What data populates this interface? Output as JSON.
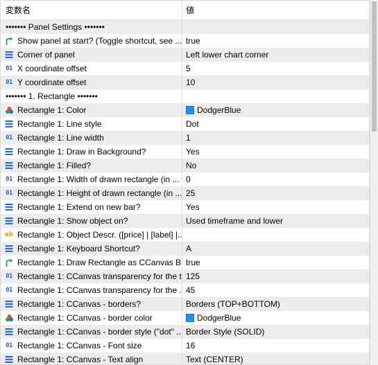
{
  "header": {
    "col_name": "変数名",
    "col_value": "値"
  },
  "rows": [
    {
      "type": "section",
      "name": "••••••• Panel Settings •••••••",
      "value": ""
    },
    {
      "icon": "arrow-green",
      "name": "Show panel at start? (Toggle shortcut, see ...",
      "value": "true"
    },
    {
      "icon": "enum",
      "name": "Corner of panel",
      "value": "Left lower chart corner"
    },
    {
      "icon": "int",
      "name": "X coordinate offset",
      "value": "5"
    },
    {
      "icon": "int",
      "name": "Y coordinate offset",
      "value": "10"
    },
    {
      "type": "section",
      "name": "••••••• 1. Rectangle •••••••",
      "value": ""
    },
    {
      "icon": "color",
      "name": "Rectangle 1: Color",
      "value": "DodgerBlue",
      "swatch": "#1e90ff"
    },
    {
      "icon": "enum",
      "name": "Rectangle 1: Line style",
      "value": "Dot"
    },
    {
      "icon": "int",
      "name": "Rectangle 1: Line width",
      "value": "1"
    },
    {
      "icon": "enum",
      "name": "Rectangle 1: Draw in Background?",
      "value": "Yes"
    },
    {
      "icon": "enum",
      "name": "Rectangle 1: Filled?",
      "value": "No"
    },
    {
      "icon": "int",
      "name": "Rectangle 1: Width of drawn rectangle (in ...",
      "value": "0"
    },
    {
      "icon": "int",
      "name": "Rectangle 1: Height of drawn rectangle (in ...",
      "value": "25"
    },
    {
      "icon": "enum",
      "name": "Rectangle 1: Extend on new bar?",
      "value": "Yes"
    },
    {
      "icon": "enum",
      "name": "Rectangle 1: Show object on?",
      "value": "Used timeframe and lower"
    },
    {
      "icon": "string",
      "name": "Rectangle 1: Object Descr. ([price] | [label] |...",
      "value": ""
    },
    {
      "icon": "enum",
      "name": "Rectangle 1: Keyboard Shortcut?",
      "value": "A"
    },
    {
      "icon": "arrow-green",
      "name": "Rectangle 1: Draw Rectangle as CCanvas Bit...",
      "value": "true"
    },
    {
      "icon": "int",
      "name": "Rectangle 1: CCanvas transparency for the t...",
      "value": "125"
    },
    {
      "icon": "int",
      "name": "Rectangle 1: CCanvas transparency for the ...",
      "value": "45"
    },
    {
      "icon": "enum",
      "name": "Rectangle 1: CCanvas - borders?",
      "value": "Borders (TOP+BOTTOM)"
    },
    {
      "icon": "color",
      "name": "Rectangle 1: CCanvas - border color",
      "value": "DodgerBlue",
      "swatch": "#1e90ff"
    },
    {
      "icon": "enum",
      "name": "Rectangle 1: CCanvas - border style (\"dot\" ...",
      "value": "Border Style (SOLID)"
    },
    {
      "icon": "int",
      "name": "Rectangle 1: CCanvas - Font size",
      "value": "16"
    },
    {
      "icon": "enum",
      "name": "Rectangle 1: CCanvas - Text align",
      "value": "Text (CENTER)"
    }
  ],
  "icon_labels": {
    "int": "01",
    "string": "ab"
  }
}
